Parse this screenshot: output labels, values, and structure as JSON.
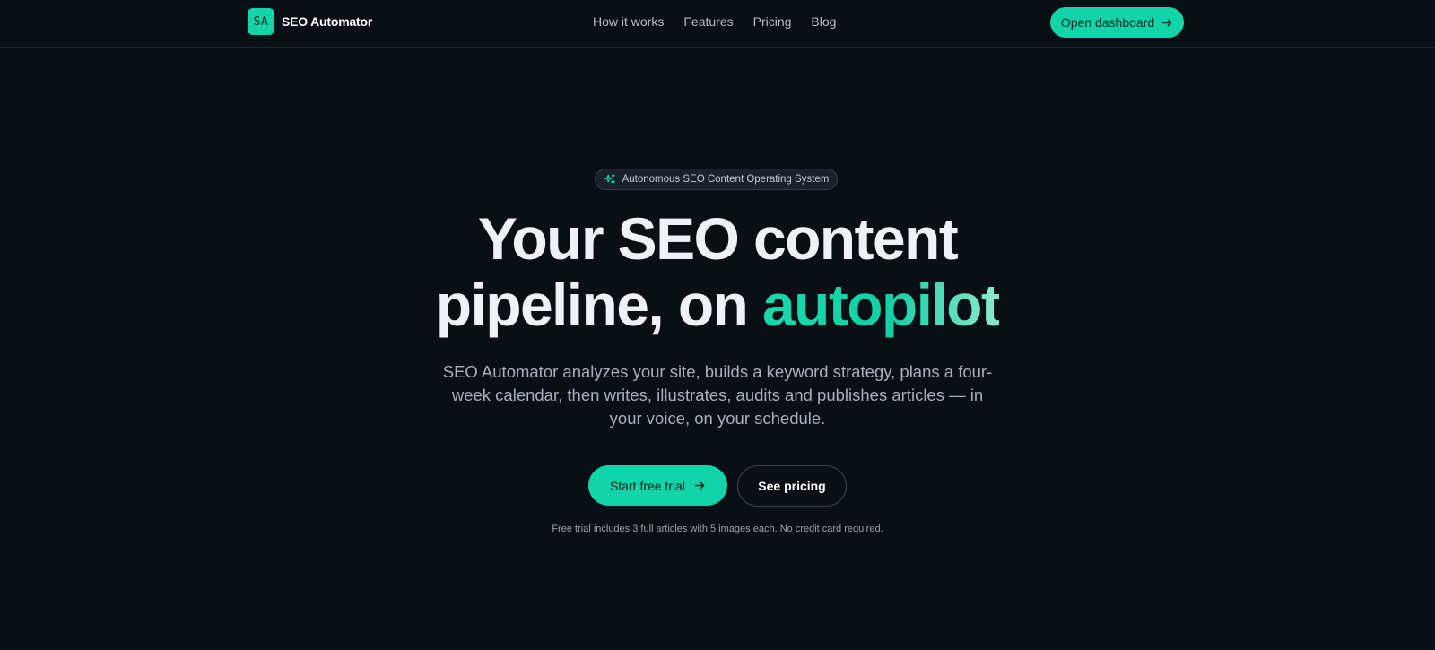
{
  "nav": {
    "logo_initials": "SA",
    "brand_name": "SEO Automator",
    "links": [
      {
        "label": "How it works"
      },
      {
        "label": "Features"
      },
      {
        "label": "Pricing"
      },
      {
        "label": "Blog"
      }
    ],
    "dashboard_button": "Open dashboard"
  },
  "hero": {
    "badge": "Autonomous SEO Content Operating System",
    "headline_line1": "Your SEO content",
    "headline_line2_prefix": "pipeline, on ",
    "headline_accent": "autopilot",
    "subtext": "SEO Automator analyzes your site, builds a keyword strategy, plans a four-week calendar, then writes, illustrates, audits and publishes articles — in your voice, on your schedule.",
    "primary_cta": "Start free trial",
    "secondary_cta": "See pricing",
    "footnote": "Free trial includes 3 full articles with 5 images each. No credit card required."
  },
  "colors": {
    "background": "#0a0e15",
    "accent": "#13d3a8",
    "text_primary": "#eef1f5",
    "text_muted": "#a9b0bb"
  },
  "icons": {
    "badge_icon": "sparkle-icon",
    "cta_icon": "arrow-right-icon"
  }
}
